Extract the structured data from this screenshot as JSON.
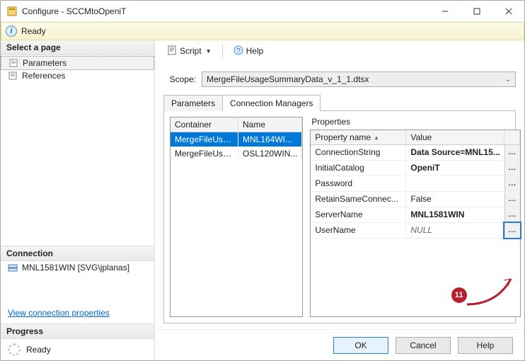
{
  "window": {
    "title": "Configure - SCCMtoOpeniT"
  },
  "status": {
    "text": "Ready"
  },
  "sidebar": {
    "select_page": "Select a page",
    "items": [
      {
        "label": "Parameters"
      },
      {
        "label": "References"
      }
    ],
    "connection_head": "Connection",
    "connection_value": "MNL1581WIN [SVG\\jplanas]",
    "link": "View connection properties",
    "progress_head": "Progress",
    "progress_text": "Ready"
  },
  "toolbar": {
    "script": "Script",
    "help": "Help"
  },
  "scope": {
    "label": "Scope:",
    "value": "MergeFileUsageSummaryData_v_1_1.dtsx"
  },
  "tabs": {
    "parameters": "Parameters",
    "connmgr": "Connection Managers"
  },
  "conn_grid": {
    "head": {
      "container": "Container",
      "name": "Name"
    },
    "rows": [
      {
        "container": "MergeFileUsag...",
        "name": "MNL164WI..."
      },
      {
        "container": "MergeFileUsag...",
        "name": "OSL120WIN..."
      }
    ]
  },
  "props": {
    "title": "Properties",
    "head": {
      "name": "Property name",
      "value": "Value"
    },
    "rows": [
      {
        "name": "ConnectionString",
        "value": "Data Source=MNL15...",
        "bold": true
      },
      {
        "name": "InitialCatalog",
        "value": "OpeniT",
        "bold": true
      },
      {
        "name": "Password",
        "value": ""
      },
      {
        "name": "RetainSameConnec...",
        "value": "False"
      },
      {
        "name": "ServerName",
        "value": "MNL1581WIN",
        "bold": true
      },
      {
        "name": "UserName",
        "value": "NULL",
        "italic": true
      }
    ]
  },
  "buttons": {
    "ok": "OK",
    "cancel": "Cancel",
    "help": "Help"
  },
  "annotation": {
    "badge": "11"
  }
}
